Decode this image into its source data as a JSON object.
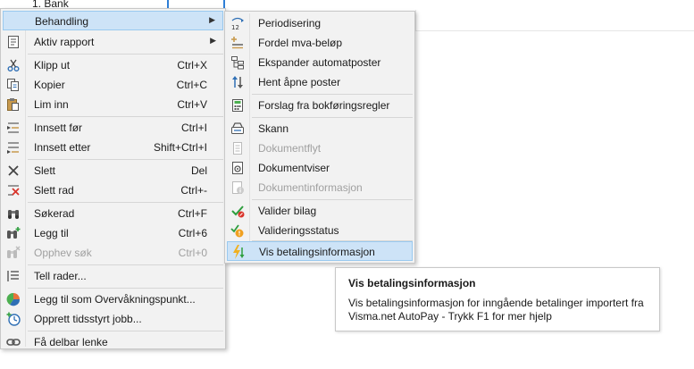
{
  "background": {
    "row_text": "1. Bank"
  },
  "main_menu": {
    "behandling": "Behandling",
    "aktiv_rapport": "Aktiv rapport",
    "klipp_ut": "Klipp ut",
    "klipp_ut_sc": "Ctrl+X",
    "kopier": "Kopier",
    "kopier_sc": "Ctrl+C",
    "lim_inn": "Lim inn",
    "lim_inn_sc": "Ctrl+V",
    "innsett_for": "Innsett før",
    "innsett_for_sc": "Ctrl+I",
    "innsett_etter": "Innsett etter",
    "innsett_etter_sc": "Shift+Ctrl+I",
    "slett": "Slett",
    "slett_sc": "Del",
    "slett_rad": "Slett rad",
    "slett_rad_sc": "Ctrl+-",
    "sokerad": "Søkerad",
    "sokerad_sc": "Ctrl+F",
    "legg_til": "Legg til",
    "legg_til_sc": "Ctrl+6",
    "opphev_sok": "Opphev søk",
    "opphev_sok_sc": "Ctrl+0",
    "tell_rader": "Tell rader...",
    "overvakning": "Legg til som Overvåkningspunkt...",
    "tidsstyrt": "Opprett tidsstyrt jobb...",
    "delbar": "Få delbar lenke"
  },
  "sub_menu": {
    "periodisering": "Periodisering",
    "fordel_mva": "Fordel mva-beløp",
    "ekspander": "Ekspander automatposter",
    "hent_apne": "Hent åpne poster",
    "forslag": "Forslag fra bokføringsregler",
    "skann": "Skann",
    "dokumentflyt": "Dokumentflyt",
    "dokumentviser": "Dokumentviser",
    "dokumentinfo": "Dokumentinformasjon",
    "valider": "Valider bilag",
    "valideringsstatus": "Valideringsstatus",
    "vis_betaling": "Vis betalingsinformasjon"
  },
  "tooltip": {
    "title": "Vis betalingsinformasjon",
    "line1": "Vis betalingsinformasjon for inngående betalinger importert fra",
    "line2": "Visma.net AutoPay - Trykk F1 for mer hjelp"
  },
  "colors": {
    "highlight": "#cde3f7",
    "highlight_border": "#99c9ef",
    "accent": "#2e7ed6"
  }
}
